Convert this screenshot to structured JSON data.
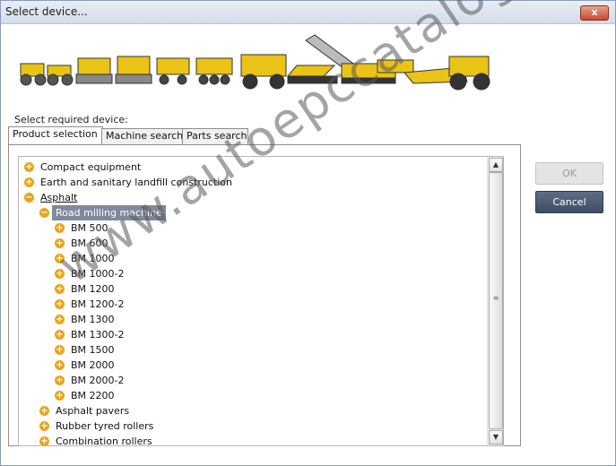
{
  "window": {
    "title": "Select device...",
    "close_label": "x"
  },
  "prompt_label": "Select required device:",
  "tabs": [
    {
      "label": "Product selection",
      "active": true
    },
    {
      "label": "Machine search",
      "active": false
    },
    {
      "label": "Parts search",
      "active": false
    }
  ],
  "tree": [
    {
      "label": "Compact equipment",
      "state": "collapsed",
      "level": 0
    },
    {
      "label": "Earth and sanitary landfill construction",
      "state": "collapsed",
      "level": 0
    },
    {
      "label": "Asphalt",
      "state": "expanded",
      "level": 0
    },
    {
      "label": "Road milling machine",
      "state": "expanded",
      "level": 1,
      "selected": true
    },
    {
      "label": "BM 500",
      "state": "collapsed",
      "level": 2
    },
    {
      "label": "BM 600",
      "state": "collapsed",
      "level": 2
    },
    {
      "label": "BM 1000",
      "state": "collapsed",
      "level": 2
    },
    {
      "label": "BM 1000-2",
      "state": "collapsed",
      "level": 2
    },
    {
      "label": "BM 1200",
      "state": "collapsed",
      "level": 2
    },
    {
      "label": "BM 1200-2",
      "state": "collapsed",
      "level": 2
    },
    {
      "label": "BM 1300",
      "state": "collapsed",
      "level": 2
    },
    {
      "label": "BM 1300-2",
      "state": "collapsed",
      "level": 2
    },
    {
      "label": "BM 1500",
      "state": "collapsed",
      "level": 2
    },
    {
      "label": "BM 2000",
      "state": "collapsed",
      "level": 2
    },
    {
      "label": "BM 2000-2",
      "state": "collapsed",
      "level": 2
    },
    {
      "label": "BM 2200",
      "state": "collapsed",
      "level": 2
    },
    {
      "label": "Asphalt pavers",
      "state": "collapsed",
      "level": 1
    },
    {
      "label": "Rubber tyred rollers",
      "state": "collapsed",
      "level": 1
    },
    {
      "label": "Combination rollers",
      "state": "collapsed",
      "level": 1
    }
  ],
  "buttons": {
    "ok_label": "OK",
    "cancel_label": "Cancel"
  },
  "watermark": "www.autoepccatalog.com",
  "colors": {
    "node_icon": "#e6a61c",
    "selection": "#7f8a9c",
    "cancel_button": "#4b5b72"
  }
}
